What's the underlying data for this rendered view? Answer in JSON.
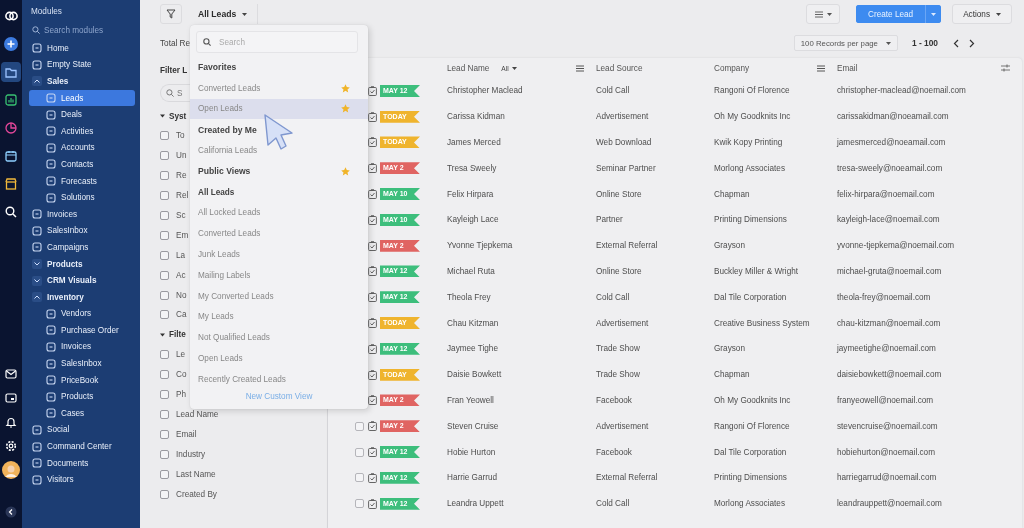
{
  "rail": {
    "top": [
      {
        "kind": "logo",
        "selected": false
      },
      {
        "kind": "add",
        "selected": false
      },
      {
        "kind": "folder",
        "selected": true
      },
      {
        "kind": "chart",
        "selected": false
      },
      {
        "kind": "pie",
        "selected": false
      },
      {
        "kind": "calendar",
        "selected": false
      },
      {
        "kind": "store",
        "selected": false
      },
      {
        "kind": "search",
        "selected": false
      }
    ],
    "bottom": [
      {
        "kind": "mail",
        "selected": false
      },
      {
        "kind": "card",
        "selected": false
      },
      {
        "kind": "bell",
        "selected": false
      },
      {
        "kind": "settings",
        "selected": false
      },
      {
        "kind": "avatar",
        "selected": false
      },
      {
        "kind": "collapse",
        "selected": false
      }
    ]
  },
  "modules": {
    "title": "Modules",
    "search": {
      "placeholder": "Search modules"
    },
    "items": [
      {
        "label": "Home",
        "selected": false
      },
      {
        "label": "Empty State",
        "selected": false
      },
      {
        "label": "Sales",
        "selected": false,
        "expanded": true,
        "children": [
          {
            "label": "Leads",
            "selected": true
          },
          {
            "label": "Deals",
            "selected": false
          },
          {
            "label": "Activities",
            "selected": false
          },
          {
            "label": "Accounts",
            "selected": false
          },
          {
            "label": "Contacts",
            "selected": false
          },
          {
            "label": "Forecasts",
            "selected": false
          },
          {
            "label": "Solutions",
            "selected": false
          }
        ]
      },
      {
        "label": "Invoices",
        "selected": false
      },
      {
        "label": "SalesInbox",
        "selected": false
      },
      {
        "label": "Campaigns",
        "selected": false
      },
      {
        "label": "Products",
        "selected": false,
        "expanded": false
      },
      {
        "label": "CRM Visuals",
        "selected": false,
        "expanded": false
      },
      {
        "label": "Inventory",
        "selected": false,
        "expanded": true,
        "children": [
          {
            "label": "Vendors",
            "selected": false
          },
          {
            "label": "Purchase Order",
            "selected": false
          },
          {
            "label": "Invoices",
            "selected": false
          },
          {
            "label": "SalesInbox",
            "selected": false
          },
          {
            "label": "PriceBook",
            "selected": false
          },
          {
            "label": "Products",
            "selected": false
          },
          {
            "label": "Cases",
            "selected": false
          }
        ]
      },
      {
        "label": "Social",
        "selected": false
      },
      {
        "label": "Command Center",
        "selected": false
      },
      {
        "label": "Documents",
        "selected": false
      },
      {
        "label": "Visitors",
        "selected": false
      }
    ]
  },
  "toolbar": {
    "view": "All Leads",
    "create": "Create Lead",
    "actions": "Actions"
  },
  "summary": {
    "total": "Total Re"
  },
  "pager": {
    "per_page": "100 Records per page",
    "range": "1 - 100"
  },
  "filters": {
    "title": "Filter L",
    "search": {
      "placeholder": "S"
    },
    "groups": [
      {
        "title": "Syst",
        "expanded": true,
        "fields": [
          {
            "label": "To",
            "checked": false
          },
          {
            "label": "Un",
            "checked": false
          },
          {
            "label": "Re",
            "checked": false
          },
          {
            "label": "Rel",
            "checked": false
          },
          {
            "label": "Sc",
            "checked": false
          },
          {
            "label": "Em",
            "checked": false
          },
          {
            "label": "La",
            "checked": false
          },
          {
            "label": "Ac",
            "checked": false
          },
          {
            "label": "No",
            "checked": false
          },
          {
            "label": "Ca",
            "checked": false
          }
        ]
      },
      {
        "title": "Filte",
        "expanded": true,
        "fields": [
          {
            "label": "Le",
            "checked": false
          },
          {
            "label": "Co",
            "checked": false
          },
          {
            "label": "Ph",
            "checked": false
          },
          {
            "label": "Lead Name",
            "checked": false
          },
          {
            "label": "Email",
            "checked": false
          },
          {
            "label": "Industry",
            "checked": false
          },
          {
            "label": "Last Name",
            "checked": false
          },
          {
            "label": "Created By",
            "checked": false
          }
        ]
      }
    ]
  },
  "views": {
    "search": {
      "placeholder": "Search"
    },
    "entries": [
      {
        "kind": "heading",
        "label": "Favorites",
        "starred": false
      },
      {
        "kind": "view",
        "label": "Converted Leads",
        "starred": true,
        "selected": false,
        "hovered": false
      },
      {
        "kind": "view",
        "label": "Open Leads",
        "starred": true,
        "selected": false,
        "hovered": true
      },
      {
        "kind": "heading",
        "label": "Created by Me",
        "starred": false
      },
      {
        "kind": "view",
        "label": "California Leads",
        "starred": false,
        "selected": false,
        "hovered": false
      },
      {
        "kind": "heading",
        "label": "Public Views",
        "starred": true
      },
      {
        "kind": "view",
        "label": "All Leads",
        "starred": false,
        "selected": true,
        "hovered": false
      },
      {
        "kind": "view",
        "label": "All Locked Leads",
        "starred": false,
        "selected": false,
        "hovered": false
      },
      {
        "kind": "view",
        "label": "Converted Leads",
        "starred": false,
        "selected": false,
        "hovered": false
      },
      {
        "kind": "view",
        "label": "Junk Leads",
        "starred": false,
        "selected": false,
        "hovered": false
      },
      {
        "kind": "view",
        "label": "Mailing Labels",
        "starred": false,
        "selected": false,
        "hovered": false
      },
      {
        "kind": "view",
        "label": "My Converted Leads",
        "starred": false,
        "selected": false,
        "hovered": false
      },
      {
        "kind": "view",
        "label": "My Leads",
        "starred": false,
        "selected": false,
        "hovered": false
      },
      {
        "kind": "view",
        "label": "Not Qualified Leads",
        "starred": false,
        "selected": false,
        "hovered": false
      },
      {
        "kind": "view",
        "label": "Open Leads",
        "starred": false,
        "selected": false,
        "hovered": false
      },
      {
        "kind": "view",
        "label": "Recently Created Leads",
        "starred": false,
        "selected": false,
        "hovered": false
      }
    ],
    "footer": "New Custom View"
  },
  "table": {
    "columns": [
      {
        "label": "Lead Name",
        "filter": "All",
        "menu": true
      },
      {
        "label": "Lead Source",
        "menu": false
      },
      {
        "label": "Company",
        "menu": true
      },
      {
        "label": "Email",
        "menu": false
      }
    ],
    "rows": [
      {
        "tag": "MAY 12",
        "color": "#3dbe7c",
        "name": "Christopher Maclead",
        "source": "Cold Call",
        "company": "Rangoni Of Florence",
        "email": "christopher-maclead@noemail.com"
      },
      {
        "tag": "TODAY",
        "color": "#efb42e",
        "name": "Carissa Kidman",
        "source": "Advertisement",
        "company": "Oh My Goodknits Inc",
        "email": "carissakidman@noeamail.com"
      },
      {
        "tag": "TODAY",
        "color": "#efb42e",
        "name": "James Merced",
        "source": "Web Download",
        "company": "Kwik Kopy Printing",
        "email": "jamesmerced@noeamail.com"
      },
      {
        "tag": "MAY 2",
        "color": "#e06462",
        "name": "Tresa Sweely",
        "source": "Seminar Partner",
        "company": "Morlong  Associates",
        "email": "tresa-sweely@noeamail.com"
      },
      {
        "tag": "MAY 10",
        "color": "#3dbe7c",
        "name": "Felix Hirpara",
        "source": "Online Store",
        "company": "Chapman",
        "email": "felix-hirpara@noemail.com"
      },
      {
        "tag": "MAY 10",
        "color": "#3dbe7c",
        "name": "Kayleigh Lace",
        "source": "Partner",
        "company": "Printing Dimensions",
        "email": "kayleigh-lace@noemail.com"
      },
      {
        "tag": "MAY 2",
        "color": "#e06462",
        "name": "Yvonne Tjepkema",
        "source": "External Referral",
        "company": "Grayson",
        "email": "yvonne-tjepkema@noemail.com"
      },
      {
        "tag": "MAY 12",
        "color": "#3dbe7c",
        "name": "Michael Ruta",
        "source": "Online Store",
        "company": "Buckley Miller & Wright",
        "email": "michael-gruta@noemail.com"
      },
      {
        "tag": "MAY 12",
        "color": "#3dbe7c",
        "name": "Theola Frey",
        "source": "Cold Call",
        "company": "Dal Tile Corporation",
        "email": "theola-frey@noemail.com"
      },
      {
        "tag": "TODAY",
        "color": "#efb42e",
        "name": "Chau Kitzman",
        "source": "Advertisement",
        "company": "Creative Business System",
        "email": "chau-kitzman@noemail.com"
      },
      {
        "tag": "MAY 12",
        "color": "#3dbe7c",
        "name": "Jaymee Tighe",
        "source": "Trade Show",
        "company": "Grayson",
        "email": "jaymeetighe@noemail.com"
      },
      {
        "tag": "TODAY",
        "color": "#efb42e",
        "name": "Daisie Bowkett",
        "source": "Trade Show",
        "company": "Chapman",
        "email": "daisiebowkett@noemail.com"
      },
      {
        "tag": "MAY 2",
        "color": "#e06462",
        "name": "Fran Yeowell",
        "source": "Facebook",
        "company": "Oh My Goodknits Inc",
        "email": "franyeowell@noemail.com"
      },
      {
        "checked": false,
        "tag": "MAY 2",
        "color": "#e06462",
        "name": "Steven Cruise",
        "source": "Advertisement",
        "company": "Rangoni Of Florence",
        "email": "stevencruise@noemail.com"
      },
      {
        "checked": false,
        "tag": "MAY 12",
        "color": "#3dbe7c",
        "name": "Hobie Hurton",
        "source": "Facebook",
        "company": "Dal Tile Corporation",
        "email": "hobiehurton@noemail.com"
      },
      {
        "checked": false,
        "tag": "MAY 12",
        "color": "#3dbe7c",
        "name": "Harrie Garrud",
        "source": "External Referral",
        "company": "Printing Dimensions",
        "email": "harriegarrud@noemail.com"
      },
      {
        "checked": false,
        "tag": "MAY 12",
        "color": "#3dbe7c",
        "name": "Leandra Uppett",
        "source": "Cold Call",
        "company": "Morlong Associates",
        "email": "leandrauppett@noemail.com"
      }
    ]
  }
}
